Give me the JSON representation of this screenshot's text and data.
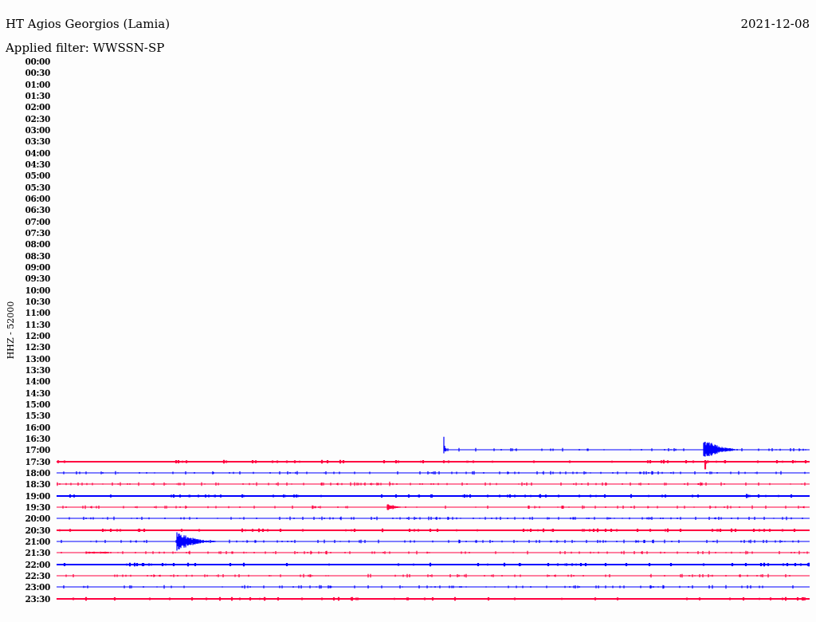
{
  "header": {
    "station": "HT Agios Georgios (Lamia)",
    "date": "2021-12-08",
    "filter": "Applied filter: WWSSN-SP"
  },
  "channel_label": "HHZ - 52000",
  "rows": [
    {
      "label": "00:00"
    },
    {
      "label": "00:30"
    },
    {
      "label": "01:00"
    },
    {
      "label": "01:30"
    },
    {
      "label": "02:00"
    },
    {
      "label": "02:30"
    },
    {
      "label": "03:00"
    },
    {
      "label": "03:30"
    },
    {
      "label": "04:00"
    },
    {
      "label": "04:30"
    },
    {
      "label": "05:00"
    },
    {
      "label": "05:30"
    },
    {
      "label": "06:00"
    },
    {
      "label": "06:30"
    },
    {
      "label": "07:00"
    },
    {
      "label": "07:30"
    },
    {
      "label": "08:00"
    },
    {
      "label": "08:30"
    },
    {
      "label": "09:00"
    },
    {
      "label": "09:30"
    },
    {
      "label": "10:00"
    },
    {
      "label": "10:30"
    },
    {
      "label": "11:00"
    },
    {
      "label": "11:30"
    },
    {
      "label": "12:00"
    },
    {
      "label": "12:30"
    },
    {
      "label": "13:00"
    },
    {
      "label": "13:30"
    },
    {
      "label": "14:00"
    },
    {
      "label": "14:30"
    },
    {
      "label": "15:00"
    },
    {
      "label": "15:30"
    },
    {
      "label": "16:00"
    },
    {
      "label": "16:30"
    },
    {
      "label": "17:00",
      "trace": {
        "kind": "partial",
        "color": "#0000ff"
      }
    },
    {
      "label": "17:30",
      "trace": {
        "kind": "full",
        "color": "#ff0040"
      }
    },
    {
      "label": "18:00",
      "trace": {
        "kind": "full",
        "color": "#0000ff"
      }
    },
    {
      "label": "18:30",
      "trace": {
        "kind": "full",
        "color": "#ff0040"
      }
    },
    {
      "label": "19:00",
      "trace": {
        "kind": "full",
        "color": "#0000ff"
      }
    },
    {
      "label": "19:30",
      "trace": {
        "kind": "full",
        "color": "#ff0040"
      }
    },
    {
      "label": "20:00",
      "trace": {
        "kind": "full",
        "color": "#0000ff"
      }
    },
    {
      "label": "20:30",
      "trace": {
        "kind": "full",
        "color": "#ff0040"
      }
    },
    {
      "label": "21:00",
      "trace": {
        "kind": "full",
        "color": "#0000ff"
      }
    },
    {
      "label": "21:30",
      "trace": {
        "kind": "full",
        "color": "#ff0040"
      }
    },
    {
      "label": "22:00",
      "trace": {
        "kind": "full",
        "color": "#0000ff"
      }
    },
    {
      "label": "22:30",
      "trace": {
        "kind": "full",
        "color": "#ff0040"
      }
    },
    {
      "label": "23:00",
      "trace": {
        "kind": "full",
        "color": "#0000ff"
      }
    },
    {
      "label": "23:30",
      "trace": {
        "kind": "full",
        "color": "#ff0040"
      }
    }
  ]
}
